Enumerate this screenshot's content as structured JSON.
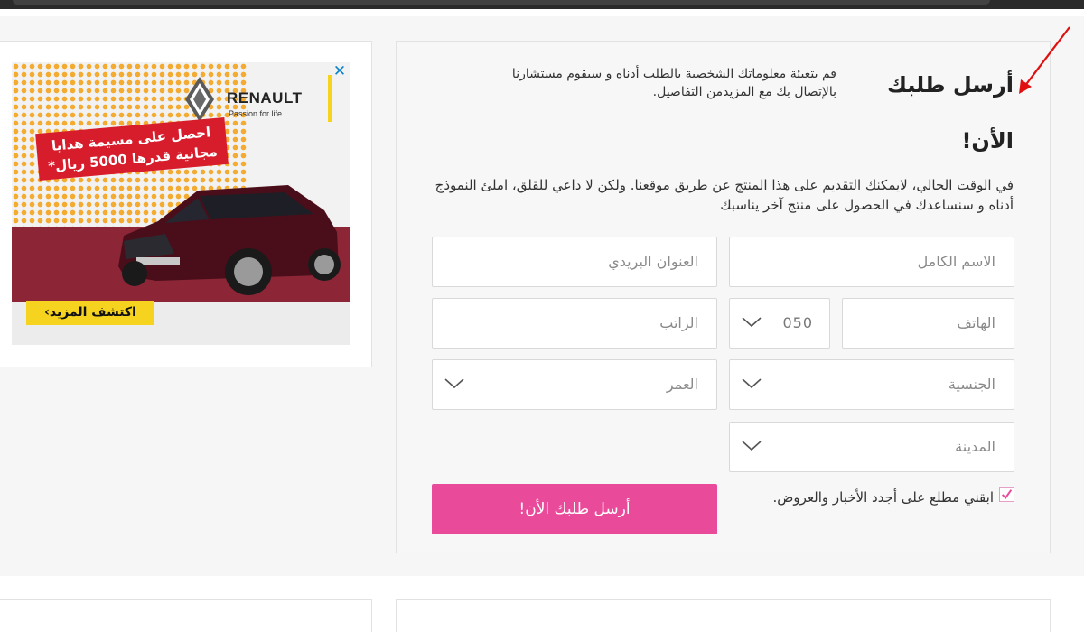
{
  "form": {
    "title_line1": "أرسل طلبك",
    "title_line2": "الأن!",
    "intro": "قم بتعبئة معلوماتك الشخصية بالطلب أدناه و سيقوم مستشارنا بالإتصال بك مع المزيدمن التفاصيل.",
    "description": "في الوقت الحالي، لايمكنك التقديم على هذا المنتج عن طريق موقعنا. ولكن لا داعي للقلق، املئ النموذج أدناه و سنساعدك في الحصول على منتج آخر يناسبك",
    "fields": {
      "full_name": "الاسم الكامل",
      "email": "العنوان البريدي",
      "phone": "الهاتف",
      "phone_prefix": "050",
      "salary": "الراتب",
      "nationality": "الجنسية",
      "age": "العمر",
      "city": "المدينة"
    },
    "newsletter_label": "ابقني مطلع على أجدد الأخبار والعروض.",
    "newsletter_checked": true,
    "submit_label": "أرسل طلبك الأن!",
    "accent_color": "#e94a9a"
  },
  "ad": {
    "brand": "RENAULT",
    "tagline": "Passion for life",
    "banner_line1": "احصل على مسيمة هدايا",
    "banner_line2": "مجانية قدرها 5000 ريال*",
    "cta": "اكتشف المزيد›",
    "close": "✕"
  }
}
